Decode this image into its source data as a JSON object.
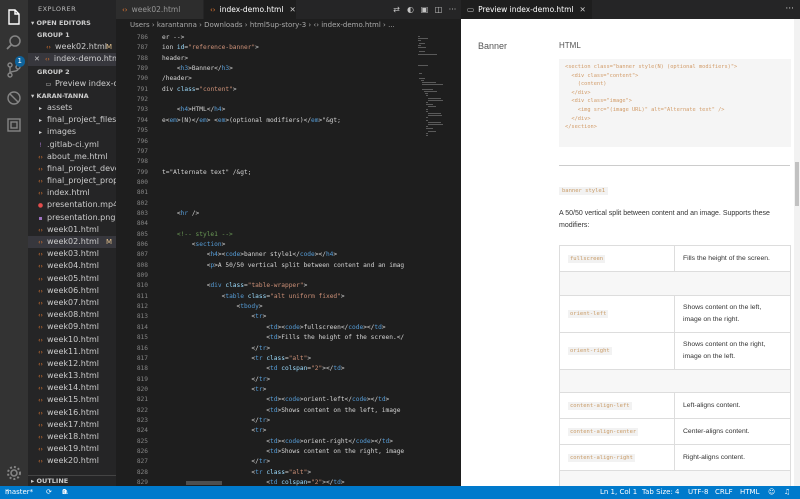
{
  "sidebar": {
    "title": "EXPLORER",
    "open_editors_label": "OPEN EDITORS",
    "group1_label": "GROUP 1",
    "group2_label": "GROUP 2",
    "open_editors": [
      {
        "name": "week02.html",
        "mod": "M",
        "group": 1
      },
      {
        "name": "index-demo.html...",
        "mod": "",
        "group": 1
      },
      {
        "name": "Preview index-d...",
        "mod": "",
        "group": 2
      }
    ],
    "project_label": "KARAN-TANNA",
    "files": [
      {
        "name": "assets",
        "kind": "folder",
        "mod": ""
      },
      {
        "name": "final_project_files",
        "kind": "folder",
        "mod": ""
      },
      {
        "name": "images",
        "kind": "folder",
        "mod": ""
      },
      {
        "name": ".gitlab-ci.yml",
        "kind": "yml",
        "mod": ""
      },
      {
        "name": "about_me.html",
        "kind": "html",
        "mod": ""
      },
      {
        "name": "final_project_develo...",
        "kind": "html",
        "mod": ""
      },
      {
        "name": "final_project_propos...",
        "kind": "html",
        "mod": ""
      },
      {
        "name": "index.html",
        "kind": "html",
        "mod": ""
      },
      {
        "name": "presentation.mp4",
        "kind": "video",
        "mod": ""
      },
      {
        "name": "presentation.png",
        "kind": "image",
        "mod": ""
      },
      {
        "name": "week01.html",
        "kind": "html",
        "mod": ""
      },
      {
        "name": "week02.html",
        "kind": "html",
        "mod": "M"
      },
      {
        "name": "week03.html",
        "kind": "html",
        "mod": ""
      },
      {
        "name": "week04.html",
        "kind": "html",
        "mod": ""
      },
      {
        "name": "week05.html",
        "kind": "html",
        "mod": ""
      },
      {
        "name": "week06.html",
        "kind": "html",
        "mod": ""
      },
      {
        "name": "week07.html",
        "kind": "html",
        "mod": ""
      },
      {
        "name": "week08.html",
        "kind": "html",
        "mod": ""
      },
      {
        "name": "week09.html",
        "kind": "html",
        "mod": ""
      },
      {
        "name": "week10.html",
        "kind": "html",
        "mod": ""
      },
      {
        "name": "week11.html",
        "kind": "html",
        "mod": ""
      },
      {
        "name": "week12.html",
        "kind": "html",
        "mod": ""
      },
      {
        "name": "week13.html",
        "kind": "html",
        "mod": ""
      },
      {
        "name": "week14.html",
        "kind": "html",
        "mod": ""
      },
      {
        "name": "week15.html",
        "kind": "html",
        "mod": ""
      },
      {
        "name": "week16.html",
        "kind": "html",
        "mod": ""
      },
      {
        "name": "week17.html",
        "kind": "html",
        "mod": ""
      },
      {
        "name": "week18.html",
        "kind": "html",
        "mod": ""
      },
      {
        "name": "week19.html",
        "kind": "html",
        "mod": ""
      },
      {
        "name": "week20.html",
        "kind": "html",
        "mod": ""
      }
    ],
    "outline_label": "OUTLINE"
  },
  "activity": {
    "badge": "1",
    "icons": [
      "files-icon",
      "search-icon",
      "source-control-icon",
      "debug-icon",
      "extensions-icon",
      "settings-icon"
    ]
  },
  "editor": {
    "tabs": [
      {
        "label": "week02.html",
        "active": false
      },
      {
        "label": "index-demo.html",
        "active": true
      }
    ],
    "breadcrumb": "Users › karantanna › Downloads › html5up-story-3 › ‹› index-demo.html › ...",
    "lines": [
      {
        "n": "786",
        "t": [
          [
            "txt",
            "er -->"
          ]
        ]
      },
      {
        "n": "787",
        "t": [
          [
            "txt",
            "ion "
          ],
          [
            "att",
            "id"
          ],
          [
            "txt",
            "="
          ],
          [
            "str",
            "\"reference-banner\""
          ],
          [
            "txt",
            ">"
          ]
        ]
      },
      {
        "n": "788",
        "t": [
          [
            "txt",
            "header>"
          ]
        ]
      },
      {
        "n": "789",
        "t": [
          [
            "txt",
            "    <"
          ],
          [
            "tag",
            "h3"
          ],
          [
            "txt",
            ">Banner</"
          ],
          [
            "tag",
            "h3"
          ],
          [
            "txt",
            ">"
          ]
        ]
      },
      {
        "n": "790",
        "t": [
          [
            "txt",
            "/header>"
          ]
        ]
      },
      {
        "n": "791",
        "t": [
          [
            "txt",
            "div "
          ],
          [
            "att",
            "class"
          ],
          [
            "txt",
            "="
          ],
          [
            "str",
            "\"content\""
          ],
          [
            "txt",
            ">"
          ]
        ]
      },
      {
        "n": "792",
        "t": [
          [
            "txt",
            ""
          ]
        ]
      },
      {
        "n": "793",
        "t": [
          [
            "txt",
            "    <"
          ],
          [
            "tag",
            "h4"
          ],
          [
            "txt",
            ">HTML</"
          ],
          [
            "tag",
            "h4"
          ],
          [
            "txt",
            ">"
          ]
        ]
      },
      {
        "n": "794",
        "t": [
          [
            "txt",
            "e<"
          ],
          [
            "tag",
            "em"
          ],
          [
            "txt",
            ">(N)</"
          ],
          [
            "tag",
            "em"
          ],
          [
            "txt",
            "> <"
          ],
          [
            "tag",
            "em"
          ],
          [
            "txt",
            ">(optional modifiers)</"
          ],
          [
            "tag",
            "em"
          ],
          [
            "txt",
            ">\"&gt;"
          ]
        ]
      },
      {
        "n": "795",
        "t": [
          [
            "txt",
            ""
          ]
        ]
      },
      {
        "n": "796",
        "t": [
          [
            "txt",
            ""
          ]
        ]
      },
      {
        "n": "797",
        "t": [
          [
            "txt",
            ""
          ]
        ]
      },
      {
        "n": "798",
        "t": [
          [
            "txt",
            ""
          ]
        ]
      },
      {
        "n": "799",
        "t": [
          [
            "txt",
            "t=\"Alternate text\" /&gt;"
          ]
        ]
      },
      {
        "n": "800",
        "t": [
          [
            "txt",
            ""
          ]
        ]
      },
      {
        "n": "801",
        "t": [
          [
            "txt",
            ""
          ]
        ]
      },
      {
        "n": "802",
        "t": [
          [
            "txt",
            ""
          ]
        ]
      },
      {
        "n": "803",
        "t": [
          [
            "txt",
            "    <"
          ],
          [
            "tag",
            "hr"
          ],
          [
            "txt",
            " />"
          ]
        ]
      },
      {
        "n": "804",
        "t": [
          [
            "txt",
            ""
          ]
        ]
      },
      {
        "n": "805",
        "t": [
          [
            "com",
            "    <!-- style1 -->"
          ]
        ]
      },
      {
        "n": "806",
        "t": [
          [
            "txt",
            "        <"
          ],
          [
            "tag",
            "section"
          ],
          [
            "txt",
            ">"
          ]
        ]
      },
      {
        "n": "807",
        "t": [
          [
            "txt",
            "            <"
          ],
          [
            "tag",
            "h4"
          ],
          [
            "txt",
            "><"
          ],
          [
            "tag",
            "code"
          ],
          [
            "txt",
            ">banner style1</"
          ],
          [
            "tag",
            "code"
          ],
          [
            "txt",
            "></"
          ],
          [
            "tag",
            "h4"
          ],
          [
            "txt",
            ">"
          ]
        ]
      },
      {
        "n": "808",
        "t": [
          [
            "txt",
            "            <"
          ],
          [
            "tag",
            "p"
          ],
          [
            "txt",
            ">A 50/50 vertical split between content and an imag"
          ]
        ]
      },
      {
        "n": "809",
        "t": [
          [
            "txt",
            ""
          ]
        ]
      },
      {
        "n": "810",
        "t": [
          [
            "txt",
            "            <"
          ],
          [
            "tag",
            "div"
          ],
          [
            "txt",
            " "
          ],
          [
            "att",
            "class"
          ],
          [
            "txt",
            "="
          ],
          [
            "str",
            "\"table-wrapper\""
          ],
          [
            "txt",
            ">"
          ]
        ]
      },
      {
        "n": "811",
        "t": [
          [
            "txt",
            "                <"
          ],
          [
            "tag",
            "table"
          ],
          [
            "txt",
            " "
          ],
          [
            "att",
            "class"
          ],
          [
            "txt",
            "="
          ],
          [
            "str",
            "\"alt uniform fixed\""
          ],
          [
            "txt",
            ">"
          ]
        ]
      },
      {
        "n": "812",
        "t": [
          [
            "txt",
            "                    <"
          ],
          [
            "tag",
            "tbody"
          ],
          [
            "txt",
            ">"
          ]
        ]
      },
      {
        "n": "813",
        "t": [
          [
            "txt",
            "                        <"
          ],
          [
            "tag",
            "tr"
          ],
          [
            "txt",
            ">"
          ]
        ]
      },
      {
        "n": "814",
        "t": [
          [
            "txt",
            "                            <"
          ],
          [
            "tag",
            "td"
          ],
          [
            "txt",
            "><"
          ],
          [
            "tag",
            "code"
          ],
          [
            "txt",
            ">fullscreen</"
          ],
          [
            "tag",
            "code"
          ],
          [
            "txt",
            "></"
          ],
          [
            "tag",
            "td"
          ],
          [
            "txt",
            ">"
          ]
        ]
      },
      {
        "n": "815",
        "t": [
          [
            "txt",
            "                            <"
          ],
          [
            "tag",
            "td"
          ],
          [
            "txt",
            ">Fills the height of the screen.</"
          ]
        ]
      },
      {
        "n": "816",
        "t": [
          [
            "txt",
            "                        </"
          ],
          [
            "tag",
            "tr"
          ],
          [
            "txt",
            ">"
          ]
        ]
      },
      {
        "n": "817",
        "t": [
          [
            "txt",
            "                        <"
          ],
          [
            "tag",
            "tr"
          ],
          [
            "txt",
            " "
          ],
          [
            "att",
            "class"
          ],
          [
            "txt",
            "="
          ],
          [
            "str",
            "\"alt\""
          ],
          [
            "txt",
            ">"
          ]
        ]
      },
      {
        "n": "818",
        "t": [
          [
            "txt",
            "                            <"
          ],
          [
            "tag",
            "td"
          ],
          [
            "txt",
            " "
          ],
          [
            "att",
            "colspan"
          ],
          [
            "txt",
            "="
          ],
          [
            "str",
            "\"2\""
          ],
          [
            "txt",
            "></"
          ],
          [
            "tag",
            "td"
          ],
          [
            "txt",
            ">"
          ]
        ]
      },
      {
        "n": "819",
        "t": [
          [
            "txt",
            "                        </"
          ],
          [
            "tag",
            "tr"
          ],
          [
            "txt",
            ">"
          ]
        ]
      },
      {
        "n": "820",
        "t": [
          [
            "txt",
            "                        <"
          ],
          [
            "tag",
            "tr"
          ],
          [
            "txt",
            ">"
          ]
        ]
      },
      {
        "n": "821",
        "t": [
          [
            "txt",
            "                            <"
          ],
          [
            "tag",
            "td"
          ],
          [
            "txt",
            "><"
          ],
          [
            "tag",
            "code"
          ],
          [
            "txt",
            ">orient-left</"
          ],
          [
            "tag",
            "code"
          ],
          [
            "txt",
            "></"
          ],
          [
            "tag",
            "td"
          ],
          [
            "txt",
            ">"
          ]
        ]
      },
      {
        "n": "822",
        "t": [
          [
            "txt",
            "                            <"
          ],
          [
            "tag",
            "td"
          ],
          [
            "txt",
            ">Shows content on the left, image"
          ]
        ]
      },
      {
        "n": "823",
        "t": [
          [
            "txt",
            "                        </"
          ],
          [
            "tag",
            "tr"
          ],
          [
            "txt",
            ">"
          ]
        ]
      },
      {
        "n": "824",
        "t": [
          [
            "txt",
            "                        <"
          ],
          [
            "tag",
            "tr"
          ],
          [
            "txt",
            ">"
          ]
        ]
      },
      {
        "n": "825",
        "t": [
          [
            "txt",
            "                            <"
          ],
          [
            "tag",
            "td"
          ],
          [
            "txt",
            "><"
          ],
          [
            "tag",
            "code"
          ],
          [
            "txt",
            ">orient-right</"
          ],
          [
            "tag",
            "code"
          ],
          [
            "txt",
            "></"
          ],
          [
            "tag",
            "td"
          ],
          [
            "txt",
            ">"
          ]
        ]
      },
      {
        "n": "826",
        "t": [
          [
            "txt",
            "                            <"
          ],
          [
            "tag",
            "td"
          ],
          [
            "txt",
            ">Shows content on the right, image"
          ]
        ]
      },
      {
        "n": "827",
        "t": [
          [
            "txt",
            "                        </"
          ],
          [
            "tag",
            "tr"
          ],
          [
            "txt",
            ">"
          ]
        ]
      },
      {
        "n": "828",
        "t": [
          [
            "txt",
            "                        <"
          ],
          [
            "tag",
            "tr"
          ],
          [
            "txt",
            " "
          ],
          [
            "att",
            "class"
          ],
          [
            "txt",
            "="
          ],
          [
            "str",
            "\"alt\""
          ],
          [
            "txt",
            ">"
          ]
        ]
      },
      {
        "n": "829",
        "t": [
          [
            "txt",
            "                            <"
          ],
          [
            "tag",
            "td"
          ],
          [
            "txt",
            " "
          ],
          [
            "att",
            "colspan"
          ],
          [
            "txt",
            "="
          ],
          [
            "str",
            "\"2\""
          ],
          [
            "txt",
            "></"
          ],
          [
            "tag",
            "td"
          ],
          [
            "txt",
            ">"
          ]
        ]
      },
      {
        "n": "830",
        "t": [
          [
            "txt",
            "                        </"
          ],
          [
            "tag",
            "tr"
          ],
          [
            "txt",
            ">"
          ]
        ]
      },
      {
        "n": "831",
        "t": [
          [
            "txt",
            "                        <"
          ],
          [
            "tag",
            "tr"
          ],
          [
            "txt",
            ">"
          ]
        ]
      }
    ]
  },
  "preview": {
    "tab_label": "Preview index-demo.html",
    "banner_title": "Banner",
    "html_heading": "HTML",
    "code_lines": [
      "<section class=\"banner style(N) (optional modifiers)\">",
      "  <div class=\"content\">",
      "    (content)",
      "  </div>",
      "  <div class=\"image\">",
      "    <img src=\"(image URL)\" alt=\"Alternate text\" />",
      "  </div>",
      "</section>"
    ],
    "style_code": "banner style1",
    "description": "A 50/50 vertical split between content and an image. Supports these modifiers:",
    "rows": [
      {
        "code": "fullscreen",
        "desc": "Fills the height of the screen."
      },
      {
        "code": "",
        "desc": ""
      },
      {
        "code": "orient-left",
        "desc": "Shows content on the left, image on the right."
      },
      {
        "code": "orient-right",
        "desc": "Shows content on the right, image on the left."
      },
      {
        "code": "",
        "desc": ""
      },
      {
        "code": "content-align-left",
        "desc": "Left-aligns content."
      },
      {
        "code": "content-align-center",
        "desc": "Center-aligns content."
      },
      {
        "code": "content-align-right",
        "desc": "Right-aligns content."
      },
      {
        "code": "",
        "desc": ""
      },
      {
        "code": "image-position-left",
        "desc": "Left-positions image."
      }
    ]
  },
  "status": {
    "branch": "master*",
    "errors": "0",
    "warnings": "0",
    "position": "Ln 1, Col 1",
    "tab_size": "Tab Size: 4",
    "encoding": "UTF-8",
    "eol": "CRLF",
    "language": "HTML"
  },
  "colors": {
    "statusbar": "#007acc",
    "tag": "#569cd6",
    "attr": "#9cdcfe",
    "string": "#ce9178",
    "comment": "#6a9955",
    "modified": "#e2c08d"
  }
}
